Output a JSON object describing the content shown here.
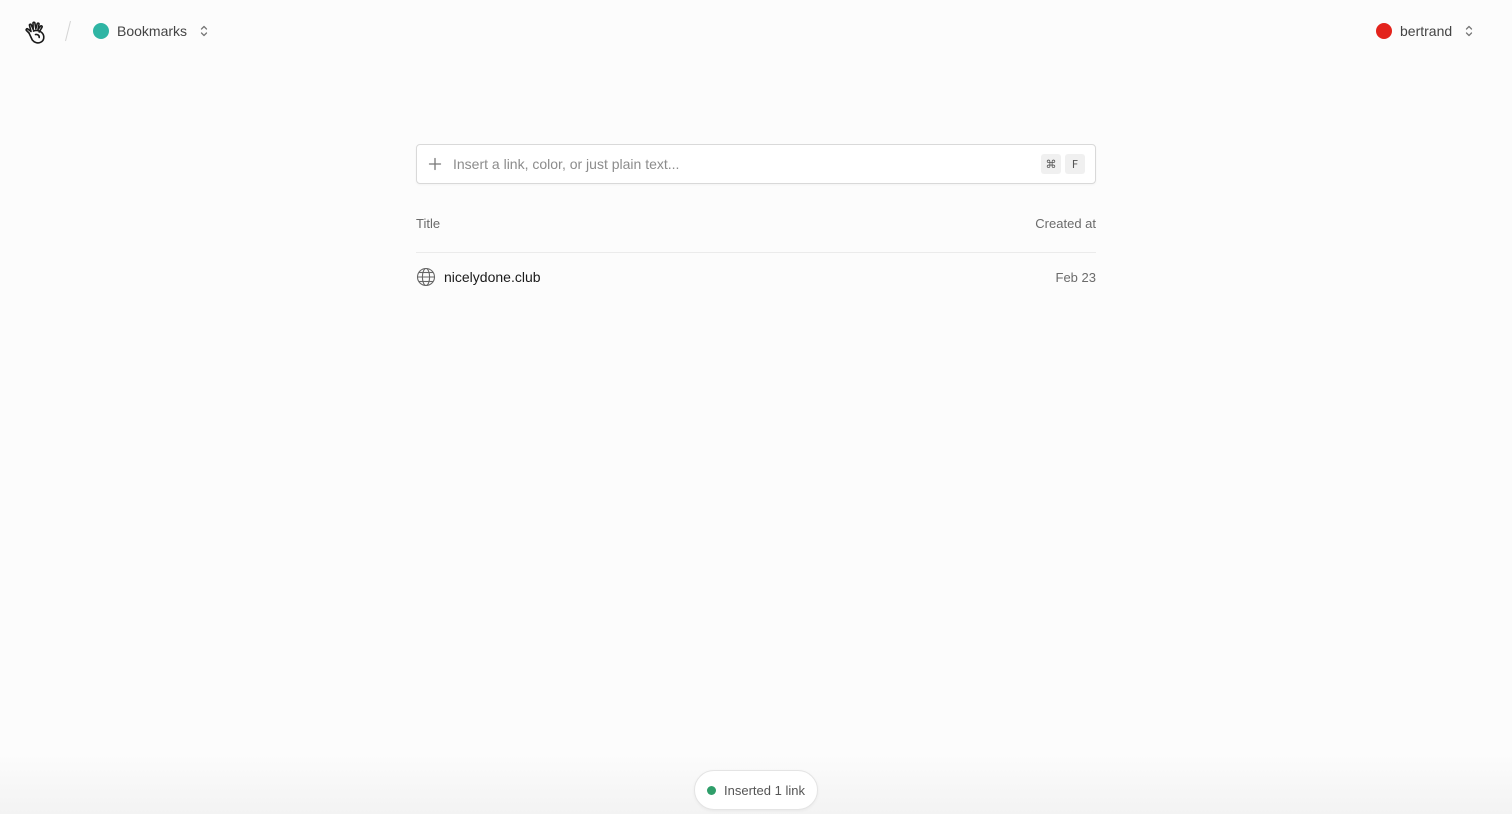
{
  "header": {
    "space": {
      "label": "Bookmarks",
      "color": "#2fb5a4"
    },
    "user": {
      "label": "bertrand",
      "color": "#e3231c"
    }
  },
  "search": {
    "placeholder": "Insert a link, color, or just plain text...",
    "value": "",
    "shortcut": [
      "⌘",
      "F"
    ]
  },
  "table": {
    "columns": {
      "title": "Title",
      "created_at": "Created at"
    },
    "rows": [
      {
        "title": "nicelydone.club",
        "created_at": "Feb 23",
        "icon": "globe-icon"
      }
    ]
  },
  "toast": {
    "message": "Inserted 1 link",
    "color": "#2f9e6a"
  },
  "icons": {
    "logo": "hand-logo-icon",
    "add": "plus-icon",
    "switch": "chevron-up-down-icon"
  }
}
